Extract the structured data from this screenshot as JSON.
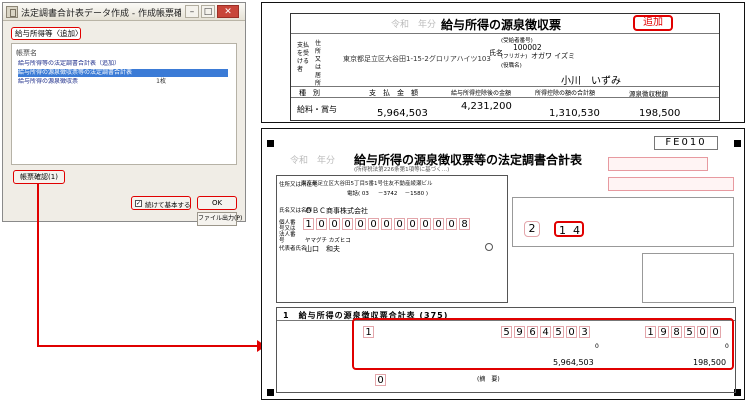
{
  "dialog": {
    "title": "法定調書合計表データ作成 - 作成帳票確認",
    "tab": "給与所得等〈追加〉",
    "list_header": "帳票名",
    "items": [
      {
        "label": "給与所得等の法定調書合計表（追加）",
        "count": ""
      },
      {
        "label": "給与所得の源泉徴収票等の法定調書合計表",
        "count": ""
      },
      {
        "label": "給与所得の源泉徴収票",
        "count": "1枚"
      }
    ],
    "preview_button": "帳票確認(1)",
    "checkbox_label": "続けて基本する",
    "ok_button": "OK",
    "print_button": "ファイル出力(P)"
  },
  "slip": {
    "year_prefix": "令和　年分",
    "title": "給与所得の源泉徴収票",
    "stamp": "追加",
    "row_labels": [
      "支払を受ける者",
      "住所又は居所"
    ],
    "address": "東京都足立区大谷田1-15-2グロリアハイツ103",
    "number_label": "(受給者番号)",
    "number": "100002",
    "kana_label": "(フリガナ)",
    "kana": "オガワ イズミ",
    "position_label": "(役職名)",
    "name_label": "氏名",
    "name": "小川　いずみ",
    "col_headers": [
      "種　別",
      "支　払　金　額",
      "給与所得控除後の金額",
      "所得控除の額の合計額",
      "源泉徴収税額"
    ],
    "type": "給料・賞与",
    "values": [
      "5,964,503",
      "4,231,200",
      "1,310,530",
      "198,500"
    ]
  },
  "summary": {
    "code": "FE010",
    "year_prefix": "令和　年分",
    "title": "給与所得の源泉徴収票等の法定調書合計表",
    "subtitle": "(所得税法第226条第1項等に基づく…)",
    "submitter_labels": [
      "住所又は所在地",
      "氏名又は名称",
      "個人番号又は法人番号",
      "代表者氏名"
    ],
    "address": "東京都足立区大谷田5丁目5番1号住友不動産綾瀬ビル",
    "tel": "電話( 03 　 －3742 　－1580 )",
    "company": "ＯＢＣ商事株式会社",
    "corp_number": [
      "1",
      "0",
      "0",
      "0",
      "0",
      "0",
      "0",
      "0",
      "0",
      "0",
      "0",
      "0",
      "8"
    ],
    "rep_kana": "ヤマグチ カズヒコ",
    "rep_name": "山口　和夫",
    "boxes": [
      "2",
      "1",
      "4"
    ],
    "section_title": "1　給与所得の源泉徴収票合計表 (375)",
    "headcount": "1",
    "amount_digits": [
      "5",
      "9",
      "6",
      "4",
      "5",
      "0",
      "3"
    ],
    "tax_digits": [
      "1",
      "9",
      "8",
      "5",
      "0",
      "0"
    ],
    "row2_zero": "0",
    "row2_zero_b": "0",
    "total_amount": "5,964,503",
    "total_tax": "198,500",
    "last_zero": "0",
    "remarks_label": "(摘　要)"
  }
}
